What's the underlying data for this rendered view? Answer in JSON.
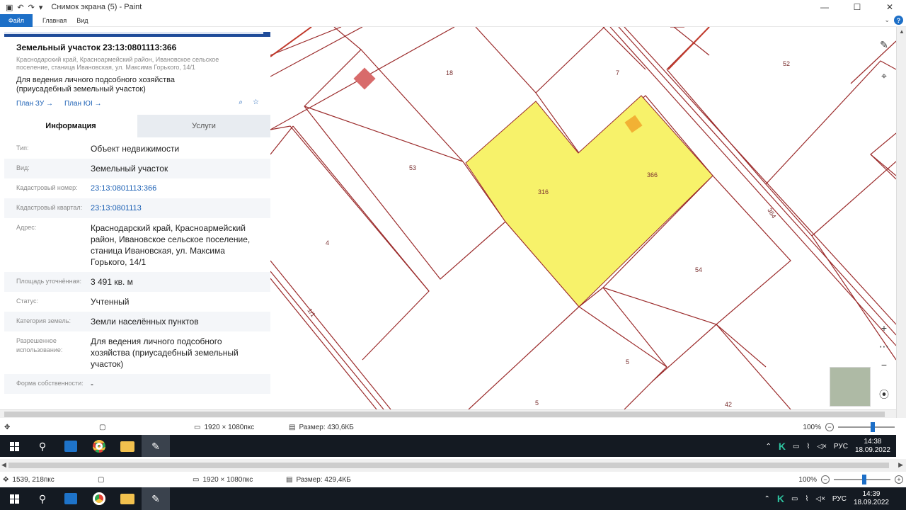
{
  "window": {
    "title": "Снимок экрана (5) - Paint",
    "ribbon_tabs": [
      "Файл",
      "Главная",
      "Вид"
    ]
  },
  "panel": {
    "title": "Земельный участок 23:13:0801113:366",
    "address_short": "Краснодарский край, Красноармейский район, Ивановское сельское поселение, станица Ивановская, ул. Максима Горького, 14/1",
    "purpose": "Для ведения личного подсобного хозяйства (приусадебный земельный участок)",
    "plan_zu": "План ЗУ →",
    "plan_ok": "План ЮI →",
    "tab_info": "Информация",
    "tab_services": "Услуги",
    "rows": [
      {
        "label": "Тип:",
        "value": "Объект недвижимости",
        "link": false
      },
      {
        "label": "Вид:",
        "value": "Земельный участок",
        "link": false
      },
      {
        "label": "Кадастровый номер:",
        "value": "23:13:0801113:366",
        "link": true
      },
      {
        "label": "Кадастровый квартал:",
        "value": "23:13:0801113",
        "link": true
      },
      {
        "label": "Адрес:",
        "value": "Краснодарский край, Красноармейский район, Ивановское сельское поселение, станица Ивановская, ул. Максима Горького, 14/1",
        "link": false
      },
      {
        "label": "Площадь уточнённая:",
        "value": "3 491 кв. м",
        "link": false
      },
      {
        "label": "Статус:",
        "value": "Учтенный",
        "link": false
      },
      {
        "label": "Категория земель:",
        "value": "Земли населённых пунктов",
        "link": false
      },
      {
        "label": "Разрешенное использование:",
        "value": "Для ведения личного подсобного хозяйства (приусадебный земельный участок)",
        "link": false
      },
      {
        "label": "Форма собственности:",
        "value": "-",
        "link": false
      }
    ]
  },
  "map": {
    "labels": {
      "p18": "18",
      "p7": "7",
      "p52": "52",
      "p53": "53",
      "p316": "316",
      "p366": "366",
      "p4": "4",
      "p54": "54",
      "p5a": "5",
      "p5b": "5",
      "p42": "42",
      "p364": "364",
      "p_street": "1/1"
    },
    "parcel_fill": "#f7f26a",
    "boundary_color": "#9b2b2b"
  },
  "status_inner": {
    "dims": "1920 × 1080пкс",
    "size": "Размер: 430,6КБ",
    "zoom": "100%"
  },
  "taskbar_inner": {
    "lang": "РУС",
    "time": "14:38",
    "date": "18.09.2022"
  },
  "status_outer": {
    "coords": "1539, 218пкс",
    "dims": "1920 × 1080пкс",
    "size": "Размер: 429,4КБ",
    "zoom": "100%"
  },
  "taskbar_outer": {
    "lang": "РУС",
    "time": "14:39",
    "date": "18.09.2022"
  }
}
